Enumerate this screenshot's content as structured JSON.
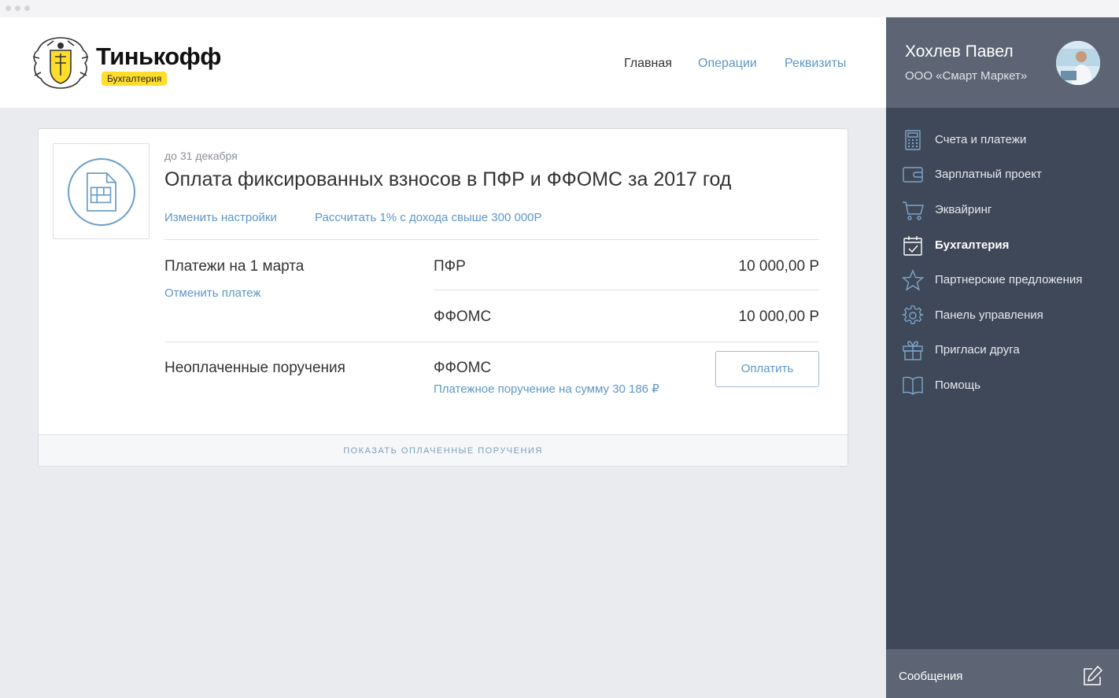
{
  "header": {
    "brand_name": "Тинькофф",
    "brand_badge": "Бухгалтерия",
    "nav": [
      {
        "label": "Главная",
        "active": true
      },
      {
        "label": "Операции",
        "active": false
      },
      {
        "label": "Реквизиты",
        "active": false
      }
    ]
  },
  "task": {
    "due": "до 31 декабря",
    "title": "Оплата фиксированных взносов в ПФР и ФФОМС за 2017 год",
    "links": [
      "Изменить настройки",
      "Рассчитать 1% с дохода свыше 300 000Р"
    ],
    "payments_label": "Платежи на 1 марта",
    "cancel_link": "Отменить платеж",
    "payments": [
      {
        "name": "ПФР",
        "amount": "10 000,00 Р"
      },
      {
        "name": "ФФОМС",
        "amount": "10 000,00 Р"
      }
    ],
    "unpaid_label": "Неоплаченные поручения",
    "unpaid_name": "ФФОМС",
    "unpaid_detail": "Платежное поручение на сумму  30 186 ₽",
    "pay_button": "Оплатить",
    "footer": "ПОКАЗАТЬ ОПЛАЧЕННЫЕ ПОРУЧЕНИЯ"
  },
  "sidebar": {
    "user_name": "Хохлев Павел",
    "company": "ООО «Смарт Маркет»",
    "items": [
      {
        "label": "Счета и платежи",
        "icon": "calculator-icon",
        "active": false
      },
      {
        "label": "Зарплатный проект",
        "icon": "wallet-icon",
        "active": false
      },
      {
        "label": "Эквайринг",
        "icon": "cart-icon",
        "active": false
      },
      {
        "label": "Бухгалтерия",
        "icon": "calendar-check-icon",
        "active": true
      },
      {
        "label": "Партнерские предложения",
        "icon": "star-icon",
        "active": false
      },
      {
        "label": "Панель управления",
        "icon": "gear-icon",
        "active": false
      },
      {
        "label": "Пригласи друга",
        "icon": "gift-icon",
        "active": false
      },
      {
        "label": "Помощь",
        "icon": "book-icon",
        "active": false
      }
    ],
    "messages": "Сообщения"
  },
  "colors": {
    "accent": "#5e97c8",
    "brand_yellow": "#ffdd2d",
    "sidebar_bg": "#3f4858",
    "sidebar_panel": "#5d6575",
    "page_bg": "#e9ebee"
  }
}
